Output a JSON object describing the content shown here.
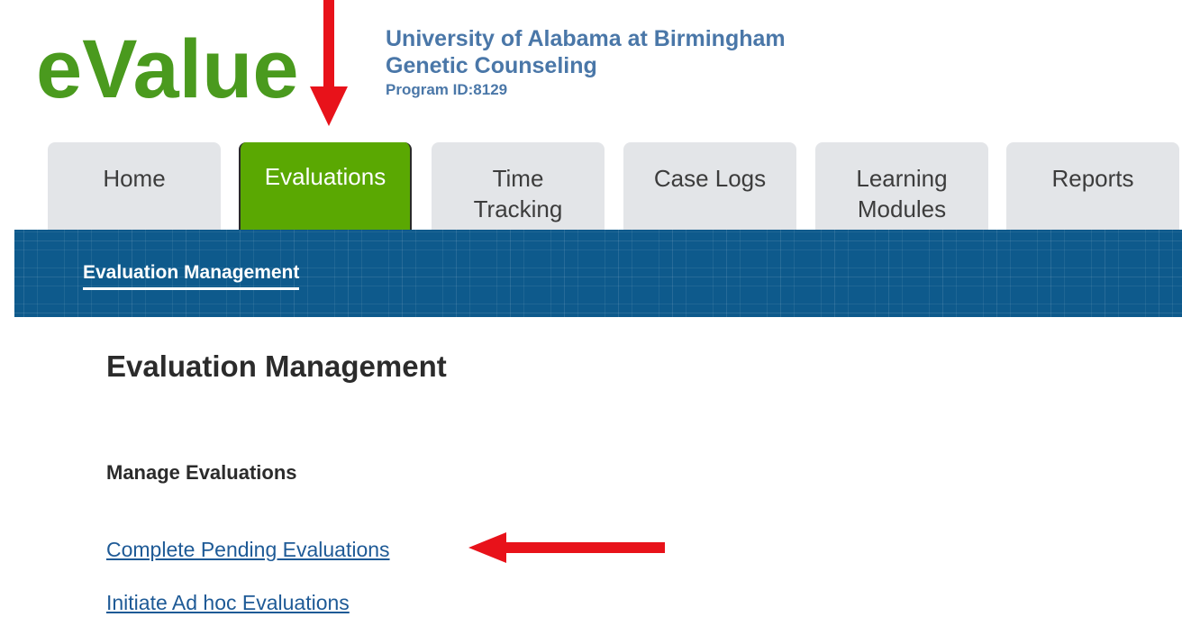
{
  "logo": {
    "text": "eValue"
  },
  "org": {
    "name": "University of Alabama at Birmingham",
    "program": "Genetic Counseling",
    "program_id": "Program ID:8129"
  },
  "tabs": [
    {
      "label": "Home"
    },
    {
      "label": "Evaluations"
    },
    {
      "label_line1": "Time",
      "label_line2": "Tracking"
    },
    {
      "label": "Case Logs"
    },
    {
      "label_line1": "Learning",
      "label_line2": "Modules"
    },
    {
      "label": "Reports"
    }
  ],
  "subnav": {
    "link": "Evaluation Management"
  },
  "main": {
    "title": "Evaluation Management",
    "section_title": "Manage Evaluations",
    "links": [
      "Complete Pending Evaluations",
      "Initiate Ad hoc Evaluations"
    ]
  },
  "colors": {
    "active_tab": "#5aa802",
    "band": "#0e5a8c",
    "link": "#1e5a96",
    "annotation_arrow": "#e8121a"
  }
}
